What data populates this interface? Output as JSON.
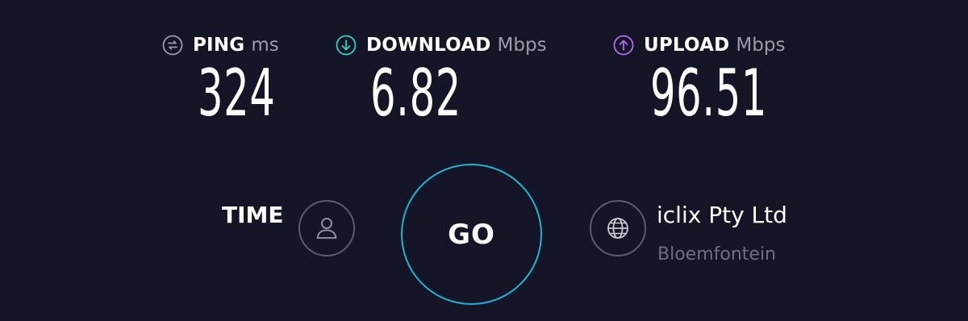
{
  "metrics": {
    "ping": {
      "label": "PING",
      "unit": "ms",
      "value": "324",
      "icon": "ping-icon",
      "color": "#9b9ba9"
    },
    "download": {
      "label": "DOWNLOAD",
      "unit": "Mbps",
      "value": "6.82",
      "icon": "download-arrow-icon",
      "color": "#2ed3c6"
    },
    "upload": {
      "label": "UPLOAD",
      "unit": "Mbps",
      "value": "96.51",
      "icon": "upload-arrow-icon",
      "color": "#b46cf5"
    }
  },
  "controls": {
    "time_label": "TIME",
    "results_icon": "user-icon",
    "go_label": "GO",
    "go_ring_color": "#21b5d3",
    "server_icon": "globe-icon"
  },
  "server": {
    "provider": "iclix Pty Ltd",
    "location": "Bloemfontein"
  },
  "theme": {
    "background": "#141526",
    "text": "#ffffff",
    "muted": "#9b9ba9",
    "ring": "#5b5c6c"
  }
}
